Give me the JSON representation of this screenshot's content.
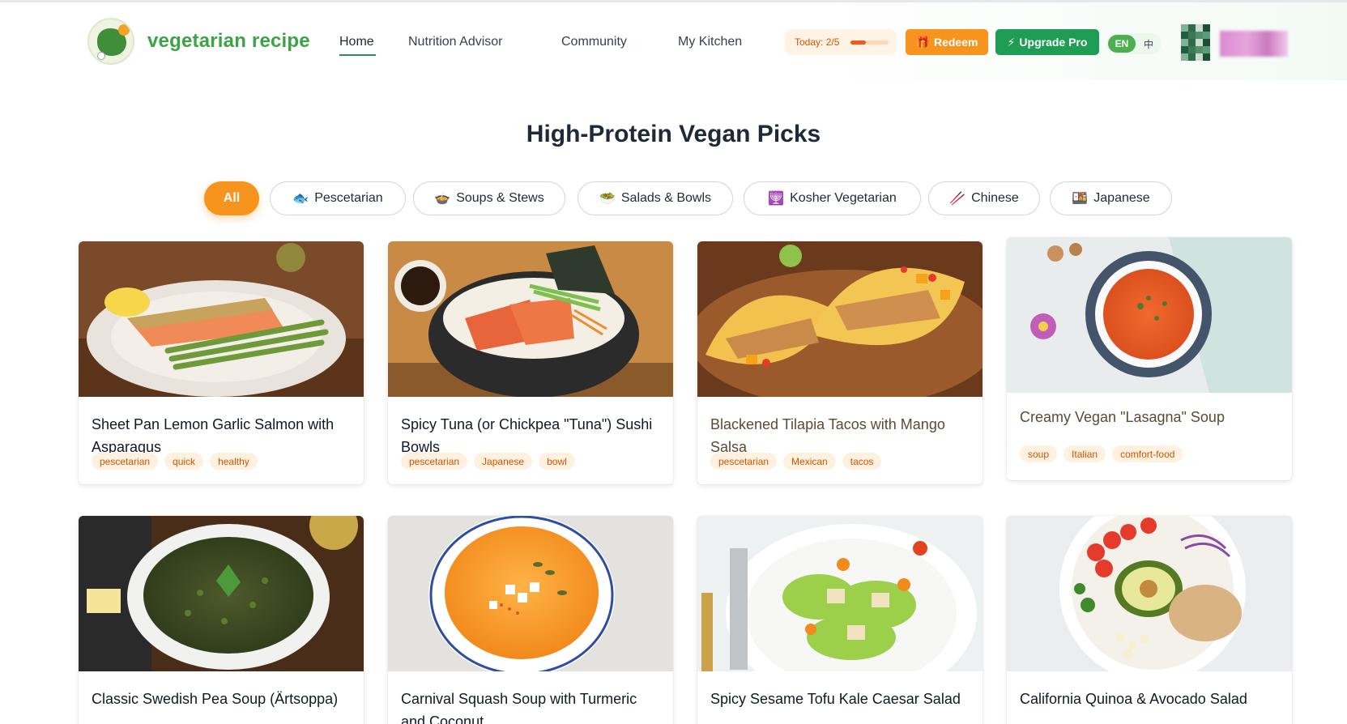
{
  "brand": {
    "name": "vegetarian recipe"
  },
  "nav": [
    {
      "label": "Home",
      "active": true
    },
    {
      "label": "Nutrition Advisor"
    },
    {
      "label": "Community"
    },
    {
      "label": "My Kitchen"
    }
  ],
  "today": {
    "label": "Today: 2/5",
    "progress": 0.4
  },
  "actions": {
    "redeem": "Redeem",
    "upgrade": "Upgrade Pro"
  },
  "lang": {
    "en": "EN",
    "zh": "中"
  },
  "page_title": "High-Protein Vegan Picks",
  "filters": [
    {
      "label": "All",
      "icon": "",
      "active": true
    },
    {
      "label": "Pescetarian",
      "icon": "🐟"
    },
    {
      "label": "Soups & Stews",
      "icon": "🍲"
    },
    {
      "label": "Salads & Bowls",
      "icon": "🥗"
    },
    {
      "label": "Kosher Vegetarian",
      "icon": "🕎"
    },
    {
      "label": "Chinese",
      "icon": "🥢"
    },
    {
      "label": "Japanese",
      "icon": "🍱"
    }
  ],
  "recipes": [
    {
      "title": "Sheet Pan Lemon Garlic Salmon with Asparagus",
      "tags": [
        "pescetarian",
        "quick",
        "healthy"
      ],
      "image": "salmon-asparagus"
    },
    {
      "title": "Spicy Tuna (or Chickpea \"Tuna\") Sushi Bowls",
      "tags": [
        "pescetarian",
        "Japanese",
        "bowl"
      ],
      "image": "sushi-bowl"
    },
    {
      "title": "Blackened Tilapia Tacos with Mango Salsa",
      "tags": [
        "pescetarian",
        "Mexican",
        "tacos"
      ],
      "image": "tilapia-tacos"
    },
    {
      "title": "Creamy Vegan \"Lasagna\" Soup",
      "tags": [
        "soup",
        "Italian",
        "comfort-food"
      ],
      "image": "tomato-soup"
    },
    {
      "title": "Classic Swedish Pea Soup (Ärtsoppa)",
      "tags": [],
      "image": "pea-soup"
    },
    {
      "title": "Carnival Squash Soup with Turmeric and Coconut",
      "tags": [],
      "image": "squash-soup"
    },
    {
      "title": "Spicy Sesame Tofu Kale Caesar Salad",
      "tags": [],
      "image": "caesar-salad"
    },
    {
      "title": "California Quinoa & Avocado Salad",
      "tags": [],
      "image": "quinoa-salad"
    }
  ]
}
